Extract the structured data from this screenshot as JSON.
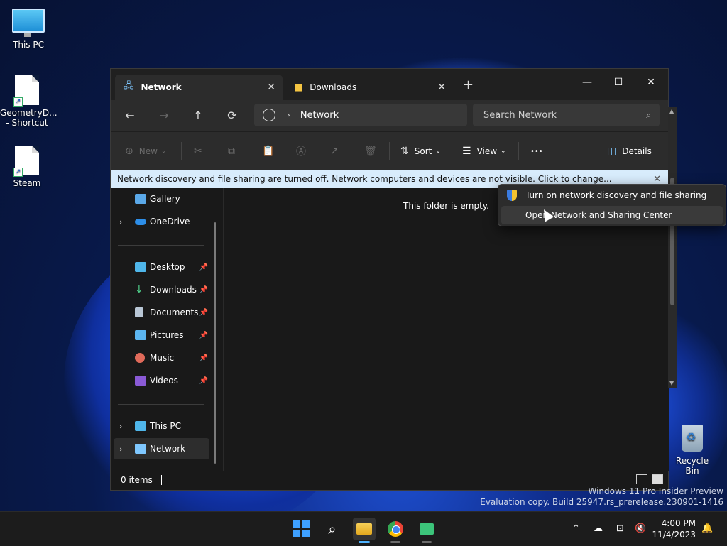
{
  "desktop": {
    "icons": [
      {
        "label": "This PC",
        "icon": "monitor-icon"
      },
      {
        "label": "GeometryD...\n- Shortcut",
        "icon": "shortcut-file-icon"
      },
      {
        "label": "Steam",
        "icon": "shortcut-file-icon"
      }
    ],
    "recycle_bin": "Recycle Bin",
    "watermark_line1": "Windows 11 Pro Insider Preview",
    "watermark_line2": "Evaluation copy. Build 25947.rs_prerelease.230901-1416"
  },
  "window": {
    "tabs": [
      {
        "label": "Network",
        "icon": "network-icon",
        "active": true
      },
      {
        "label": "Downloads",
        "icon": "folder-icon",
        "active": false
      }
    ],
    "new_tab": "+",
    "controls": {
      "minimize": "—",
      "maximize": "☐",
      "close": "✕"
    },
    "nav": {
      "back": "←",
      "forward": "→",
      "up": "↑",
      "refresh": "⟳"
    },
    "address": {
      "location": "Network",
      "separator": "›"
    },
    "search": {
      "placeholder": "Search Network"
    },
    "commands": {
      "new": "New",
      "sort": "Sort",
      "view": "View",
      "more": "•••",
      "details": "Details"
    },
    "infobar": "Network discovery and file sharing are turned off. Network computers and devices are not visible. Click to change...",
    "sidebar": {
      "items_top": [
        {
          "label": "Gallery",
          "icon": "gallery-icon"
        },
        {
          "label": "OneDrive",
          "icon": "onedrive-icon"
        }
      ],
      "quick_access": [
        {
          "label": "Desktop",
          "icon": "desktop-icon"
        },
        {
          "label": "Downloads",
          "icon": "downloads-icon"
        },
        {
          "label": "Documents",
          "icon": "documents-icon"
        },
        {
          "label": "Pictures",
          "icon": "pictures-icon"
        },
        {
          "label": "Music",
          "icon": "music-icon"
        },
        {
          "label": "Videos",
          "icon": "videos-icon"
        }
      ],
      "items_bottom": [
        {
          "label": "This PC",
          "icon": "this-pc-icon"
        },
        {
          "label": "Network",
          "icon": "network-icon",
          "selected": true
        }
      ]
    },
    "empty_message": "This folder is empty.",
    "status": "0 items"
  },
  "context_menu": {
    "items": [
      {
        "label": "Turn on network discovery and file sharing",
        "icon": "shield-icon"
      },
      {
        "label": "Open Network and Sharing Center"
      }
    ]
  },
  "taskbar": {
    "apps": [
      "start-icon",
      "search-icon",
      "file-explorer-icon",
      "chrome-icon",
      "app-icon"
    ],
    "clock_time": "4:00 PM",
    "clock_date": "11/4/2023"
  },
  "colors": {
    "accent": "#4fb3ff",
    "infobar_bg": "#d8ecfc",
    "window_bg": "#191919"
  }
}
